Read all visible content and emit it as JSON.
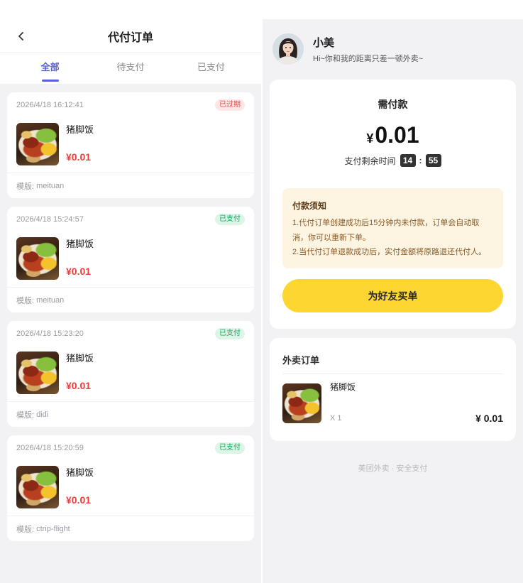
{
  "colors": {
    "accent": "#5a5fd6",
    "price": "#f23c3c",
    "button": "#fdd631",
    "expired_text": "#e84a4a",
    "expired_bg": "#fde6e6",
    "paid_text": "#17a35a",
    "paid_bg": "#dcf5e7",
    "notice_bg": "#fdf4e2",
    "notice_title": "#5e3b14",
    "notice_text": "#8a5a25",
    "timer_bg": "#333333"
  },
  "icons": {
    "back": "chevron-left-icon"
  },
  "header": {
    "title": "代付订单"
  },
  "tabs": [
    {
      "label": "全部",
      "active": true
    },
    {
      "label": "待支付",
      "active": false
    },
    {
      "label": "已支付",
      "active": false
    }
  ],
  "labels": {
    "template": "模版:"
  },
  "orders": [
    {
      "time": "2026/4/18 16:12:41",
      "status": "已过期",
      "expired": true,
      "name": "猪脚饭",
      "price": "¥0.01",
      "template": "meituan"
    },
    {
      "time": "2026/4/18 15:24:57",
      "status": "已支付",
      "expired": false,
      "name": "猪脚饭",
      "price": "¥0.01",
      "template": "meituan"
    },
    {
      "time": "2026/4/18 15:23:20",
      "status": "已支付",
      "expired": false,
      "name": "猪脚饭",
      "price": "¥0.01",
      "template": "didi"
    },
    {
      "time": "2026/4/18 15:20:59",
      "status": "已支付",
      "expired": false,
      "name": "猪脚饭",
      "price": "¥0.01",
      "template": "ctrip-flight"
    }
  ],
  "user": {
    "name": "小美",
    "greeting": "Hi~你和我的距离只差一顿外卖~"
  },
  "payment": {
    "title": "需付款",
    "currency": "¥",
    "amount": "0.01",
    "countdown": {
      "label": "支付剩余时间",
      "minutes": "14",
      "separator": ":",
      "seconds": "55"
    }
  },
  "notice": {
    "title": "付款须知",
    "lines": [
      "1.代付订单创建成功后15分钟内未付款，订单会自动取消，你可以重新下单。",
      "2.当代付订单退款成功后，实付金额将原路退还代付人。"
    ]
  },
  "pay_button": {
    "label": "为好友买单"
  },
  "takeout": {
    "title": "外卖订单",
    "item": {
      "name": "猪脚饭",
      "quantity": "X 1",
      "price": "¥ 0.01"
    }
  },
  "footer": {
    "text": "美团外卖 · 安全支付"
  }
}
